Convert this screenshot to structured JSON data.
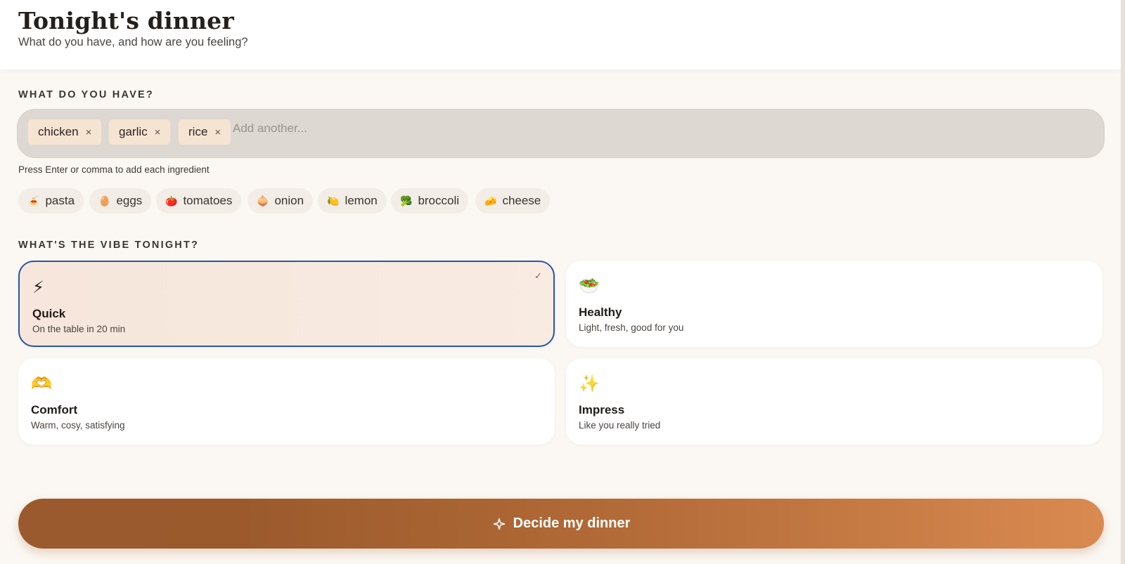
{
  "header": {
    "title": "Tonight's dinner",
    "subtitle": "What do you have, and how are you feeling?"
  },
  "ingredients": {
    "label": "WHAT DO YOU HAVE?",
    "chips": [
      "chicken",
      "garlic",
      "rice"
    ],
    "remove_glyph": "×",
    "placeholder": "Add another...",
    "hint": "Press Enter or comma to add each ingredient",
    "suggestions": [
      {
        "icon": "🍝",
        "label": "pasta"
      },
      {
        "icon": "🥚",
        "label": "eggs"
      },
      {
        "icon": "🍅",
        "label": "tomatoes"
      },
      {
        "icon": "🧅",
        "label": "onion"
      },
      {
        "icon": "🍋",
        "label": "lemon"
      },
      {
        "icon": "🥦",
        "label": "broccoli"
      },
      {
        "icon": "🧀",
        "label": "cheese"
      }
    ]
  },
  "vibe": {
    "label": "WHAT'S THE VIBE TONIGHT?",
    "options": [
      {
        "icon": "⚡",
        "title": "Quick",
        "desc": "On the table in 20 min",
        "selected": true,
        "check": "✓"
      },
      {
        "icon": "🥗",
        "title": "Healthy",
        "desc": "Light, fresh, good for you",
        "selected": false
      },
      {
        "icon": "🫶",
        "title": "Comfort",
        "desc": "Warm, cosy, satisfying",
        "selected": false
      },
      {
        "icon": "✨",
        "title": "Impress",
        "desc": "Like you really tried",
        "selected": false
      }
    ]
  },
  "cta": {
    "label": "Decide my dinner",
    "icon": "sparkle-icon"
  },
  "colors": {
    "accent": "#b26a37",
    "selected_border": "#2a56a8",
    "background": "#fbf8f3"
  }
}
